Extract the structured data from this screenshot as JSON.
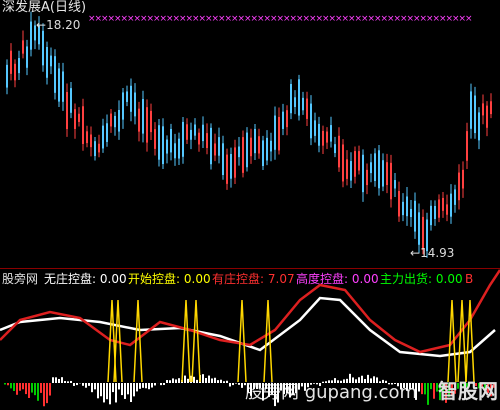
{
  "title": "深发展A(日线)",
  "high_label": "18.20",
  "low_label": "14.93",
  "indicator": {
    "name": "股旁网",
    "items": [
      {
        "label": "无庄控盘:",
        "value": "0.00",
        "color": "#ffffff"
      },
      {
        "label": "开始控盘:",
        "value": "0.00",
        "color": "#ffff00"
      },
      {
        "label": "有庄控盘:",
        "value": "7.07",
        "color": "#ff3030"
      },
      {
        "label": "高度控盘:",
        "value": "0.00",
        "color": "#ff40ff"
      },
      {
        "label": "主力出货:",
        "value": "0.00",
        "color": "#00ff00"
      }
    ],
    "scroll_mark": "B"
  },
  "watermark": "股旁网 gupang.com",
  "logo": "智股网",
  "colors": {
    "up": "#ff4040",
    "down": "#55c8ff",
    "markers": "#ff40ff",
    "line_white": "#ffffff",
    "line_red": "#dd2020",
    "spike": "#ffd700"
  }
}
